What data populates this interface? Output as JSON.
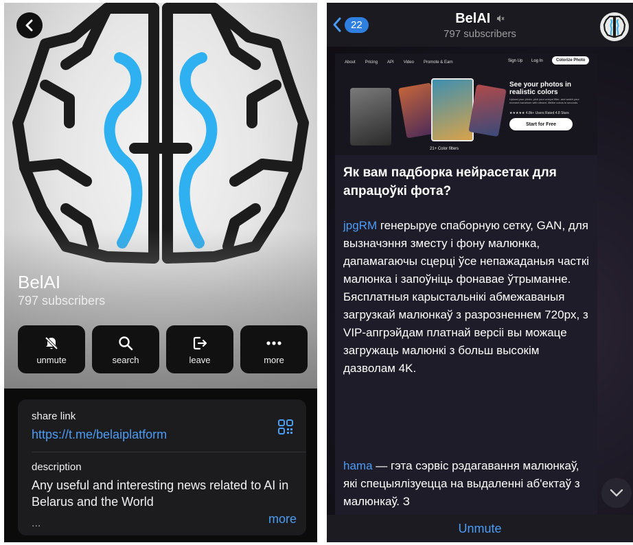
{
  "profile": {
    "back_icon": "chevron-left-icon",
    "title": "BelAI",
    "subscribers": "797 subscribers",
    "actions": [
      {
        "label": "unmute",
        "icon": "bell-slash-icon"
      },
      {
        "label": "search",
        "icon": "search-icon"
      },
      {
        "label": "leave",
        "icon": "leave-icon"
      },
      {
        "label": "more",
        "icon": "ellipsis-icon"
      }
    ],
    "share_caption": "share link",
    "share_link": "https://t.me/belaiplatform",
    "qr_icon": "qr-code-icon",
    "description_caption": "description",
    "description": "Any useful and interesting news related to AI in Belarus and the World",
    "description_ellipsis": "...",
    "more_label": "more"
  },
  "chat": {
    "back_badge": "22",
    "title": "BelAI",
    "mute_icon": "speaker-muted-icon",
    "subscribers": "797 subscribers",
    "preview": {
      "nav": [
        "About",
        "Pricing",
        "API",
        "Video",
        "Promote & Earn"
      ],
      "signup": "Sign Up",
      "login": "Log In",
      "colorize": "Colorize Photo",
      "headline": "See your photos in realistic colors",
      "small": "Upload your photo, pick your unique filter, and watch your moment transform with vibrant, lifelike colors in seconds.",
      "stars": "★★★★★ 4.8k+ Users Rated 4.8 Stars",
      "start": "Start for Free",
      "filters": "21+ Color filters"
    },
    "message_title": "Як вам падборка нейрасетак для апрацоўкі фота?",
    "p1_link": "jpgRM",
    "p1_text": " генерыруе спаборную сетку, GAN, для вызначэння зместу і фону малюнка, дапамагаючы сцерці ўсе непажаданыя часткі малюнка і запоўніць фонавае ўтрыманне. Бясплатныя карыстальнікі абмежаваныя загрузкай малюнкаў з разрозненнем 720px, з VIP-апгрэйдам платнай версіі вы можаце загружаць малюнкі з больш высокім дазволам 4K.",
    "p2_link": "hama",
    "p2_text": " — гэта сэрвіс рэдагавання малюнкаў, які спецыялізуецца на выдаленні аб'ектаў з малюнкаў. З",
    "scroll_icon": "chevron-down-icon",
    "unmute_label": "Unmute"
  },
  "colors": {
    "accent": "#4a9cf5",
    "brain_blue": "#2fb0f0",
    "brain_dark": "#1c1c1c",
    "badge": "#2f7fe0"
  }
}
